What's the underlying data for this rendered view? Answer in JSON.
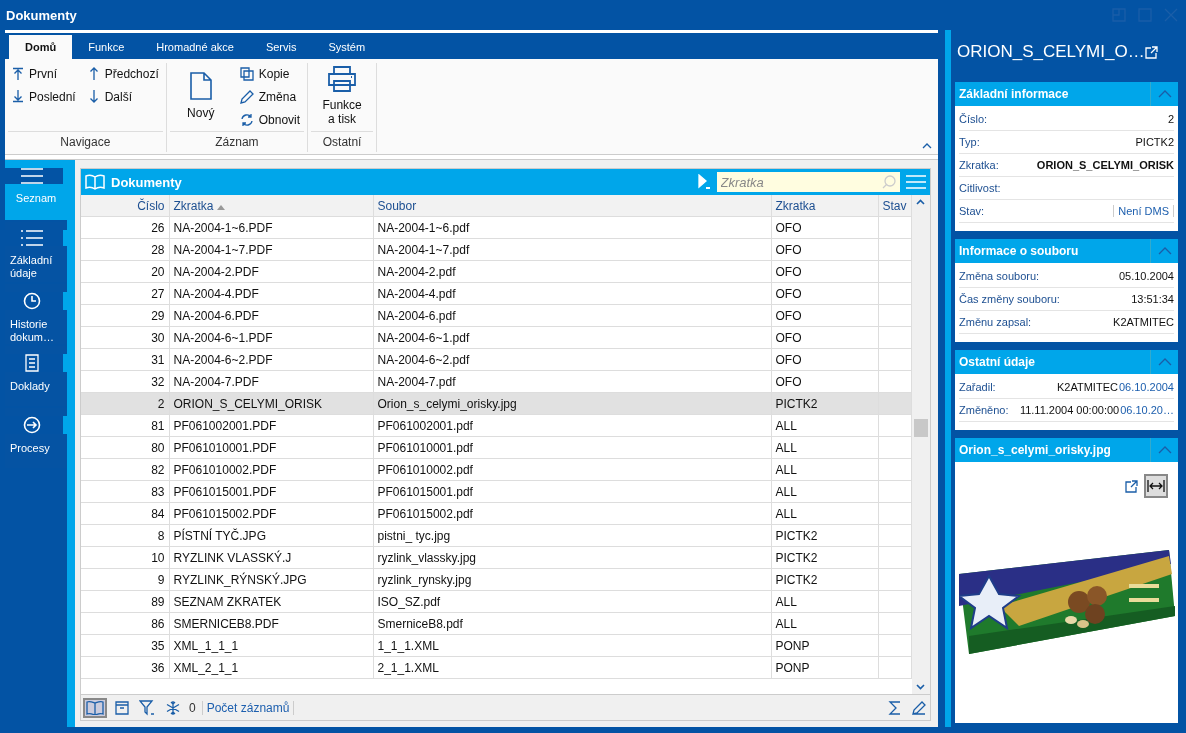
{
  "window": {
    "title": "Dokumenty"
  },
  "ribbon": {
    "tabs": [
      {
        "label": "Domů",
        "selected": true
      },
      {
        "label": "Funkce",
        "selected": false
      },
      {
        "label": "Hromadné akce",
        "selected": false
      },
      {
        "label": "Servis",
        "selected": false
      },
      {
        "label": "Systém",
        "selected": false
      }
    ],
    "groups": [
      {
        "label": "Navigace",
        "columns": [
          [
            {
              "label": "První",
              "kind": "small"
            },
            {
              "label": "Poslední",
              "kind": "small"
            }
          ],
          [
            {
              "label": "Předchozí",
              "kind": "small"
            },
            {
              "label": "Další",
              "kind": "small"
            }
          ]
        ]
      },
      {
        "label": "Záznam",
        "columns": [
          [
            {
              "label": "Nový",
              "kind": "large"
            }
          ],
          [
            {
              "label": "Kopie",
              "kind": "small"
            },
            {
              "label": "Změna",
              "kind": "small"
            },
            {
              "label": "Obnovit",
              "kind": "small"
            }
          ]
        ]
      },
      {
        "label": "Ostatní",
        "columns": [
          [
            {
              "label": "Funkce a tisk",
              "kind": "large"
            }
          ]
        ]
      }
    ]
  },
  "nav": {
    "items": [
      {
        "label": "Seznam",
        "selected": true
      },
      {
        "label": "Základní údaje",
        "selected": false
      },
      {
        "label": "Historie dokum…",
        "selected": false
      },
      {
        "label": "Doklady",
        "selected": false
      },
      {
        "label": "Procesy",
        "selected": false
      }
    ]
  },
  "grid": {
    "title": "Dokumenty",
    "search": {
      "placeholder": "Zkratka"
    },
    "columns": [
      {
        "label": "Číslo",
        "sorted": false
      },
      {
        "label": "Zkratka",
        "sorted": true
      },
      {
        "label": "Soubor",
        "sorted": false
      },
      {
        "label": "Zkratka",
        "sorted": false
      },
      {
        "label": "Stav",
        "sorted": false
      }
    ],
    "rows": [
      {
        "cells": [
          "26",
          "NA-2004-1~6.PDF",
          "NA-2004-1~6.pdf",
          "OFO",
          ""
        ],
        "selected": false
      },
      {
        "cells": [
          "28",
          "NA-2004-1~7.PDF",
          "NA-2004-1~7.pdf",
          "OFO",
          ""
        ],
        "selected": false
      },
      {
        "cells": [
          "20",
          "NA-2004-2.PDF",
          "NA-2004-2.pdf",
          "OFO",
          ""
        ],
        "selected": false
      },
      {
        "cells": [
          "27",
          "NA-2004-4.PDF",
          "NA-2004-4.pdf",
          "OFO",
          ""
        ],
        "selected": false
      },
      {
        "cells": [
          "29",
          "NA-2004-6.PDF",
          "NA-2004-6.pdf",
          "OFO",
          ""
        ],
        "selected": false
      },
      {
        "cells": [
          "30",
          "NA-2004-6~1.PDF",
          "NA-2004-6~1.pdf",
          "OFO",
          ""
        ],
        "selected": false
      },
      {
        "cells": [
          "31",
          "NA-2004-6~2.PDF",
          "NA-2004-6~2.pdf",
          "OFO",
          ""
        ],
        "selected": false
      },
      {
        "cells": [
          "32",
          "NA-2004-7.PDF",
          "NA-2004-7.pdf",
          "OFO",
          ""
        ],
        "selected": false
      },
      {
        "cells": [
          "2",
          "ORION_S_CELYMI_ORISK",
          "Orion_s_celymi_orisky.jpg",
          "PICTK2",
          ""
        ],
        "selected": true
      },
      {
        "cells": [
          "81",
          "PF061002001.PDF",
          "PF061002001.pdf",
          "ALL",
          ""
        ],
        "selected": false
      },
      {
        "cells": [
          "80",
          "PF061010001.PDF",
          "PF061010001.pdf",
          "ALL",
          ""
        ],
        "selected": false
      },
      {
        "cells": [
          "82",
          "PF061010002.PDF",
          "PF061010002.pdf",
          "ALL",
          ""
        ],
        "selected": false
      },
      {
        "cells": [
          "83",
          "PF061015001.PDF",
          "PF061015001.pdf",
          "ALL",
          ""
        ],
        "selected": false
      },
      {
        "cells": [
          "84",
          "PF061015002.PDF",
          "PF061015002.pdf",
          "ALL",
          ""
        ],
        "selected": false
      },
      {
        "cells": [
          "8",
          "PÍSTNÍ TYČ.JPG",
          "pistni_ tyc.jpg",
          "PICTK2",
          ""
        ],
        "selected": false
      },
      {
        "cells": [
          "10",
          "RYZLINK VLASSKÝ.J",
          "ryzlink_vlassky.jpg",
          "PICTK2",
          ""
        ],
        "selected": false
      },
      {
        "cells": [
          "9",
          "RYZLINK_RÝNSKÝ.JPG",
          "ryzlink_rynsky.jpg",
          "PICTK2",
          ""
        ],
        "selected": false
      },
      {
        "cells": [
          "89",
          "SEZNAM ZKRATEK",
          "ISO_SZ.pdf",
          "ALL",
          ""
        ],
        "selected": false
      },
      {
        "cells": [
          "86",
          "SMERNICEB8.PDF",
          "SmerniceB8.pdf",
          "ALL",
          ""
        ],
        "selected": false
      },
      {
        "cells": [
          "35",
          "XML_1_1_1",
          "1_1_1.XML",
          "PONP",
          ""
        ],
        "selected": false
      },
      {
        "cells": [
          "36",
          "XML_2_1_1",
          "2_1_1.XML",
          "PONP",
          ""
        ],
        "selected": false
      }
    ],
    "footer": {
      "count": "0",
      "link": "Počet záznamů"
    }
  },
  "panel": {
    "title": "ORION_S_CELYMI_O…",
    "sections": [
      {
        "title": "Základní informace",
        "expanded": true,
        "kind": "fields",
        "fields": [
          {
            "label": "Číslo:",
            "value": "2",
            "kind": "plain"
          },
          {
            "label": "Typ:",
            "value": "PICTK2",
            "kind": "plain"
          },
          {
            "label": "Zkratka:",
            "value": "ORION_S_CELYMI_ORISK",
            "kind": "bold"
          },
          {
            "label": "Citlivost:"
          },
          {
            "label": "Stav:",
            "value": "Není DMS",
            "kind": "link"
          }
        ]
      },
      {
        "title": "Informace o souboru",
        "expanded": true,
        "kind": "fields",
        "fields": [
          {
            "label": "Změna souboru:",
            "value": "05.10.2004",
            "kind": "plain"
          },
          {
            "label": "Čas změny souboru:",
            "value": "13:51:34",
            "kind": "plain"
          },
          {
            "label": "Změnu zapsal:",
            "value": "K2ATMITEC",
            "kind": "plain"
          }
        ]
      },
      {
        "title": "Ostatní údaje",
        "expanded": true,
        "kind": "fields",
        "fields": [
          {
            "label": "Zařadil:",
            "value": "K2ATMITEC",
            "note": "06.10.2004",
            "kind": "plain"
          },
          {
            "label": "Změněno:",
            "value": "11.11.2004 00:00:00",
            "note": "06.10.20…",
            "kind": "plain"
          }
        ]
      },
      {
        "title": "Orion_s_celymi_orisky.jpg",
        "expanded": true,
        "kind": "picture"
      }
    ]
  }
}
